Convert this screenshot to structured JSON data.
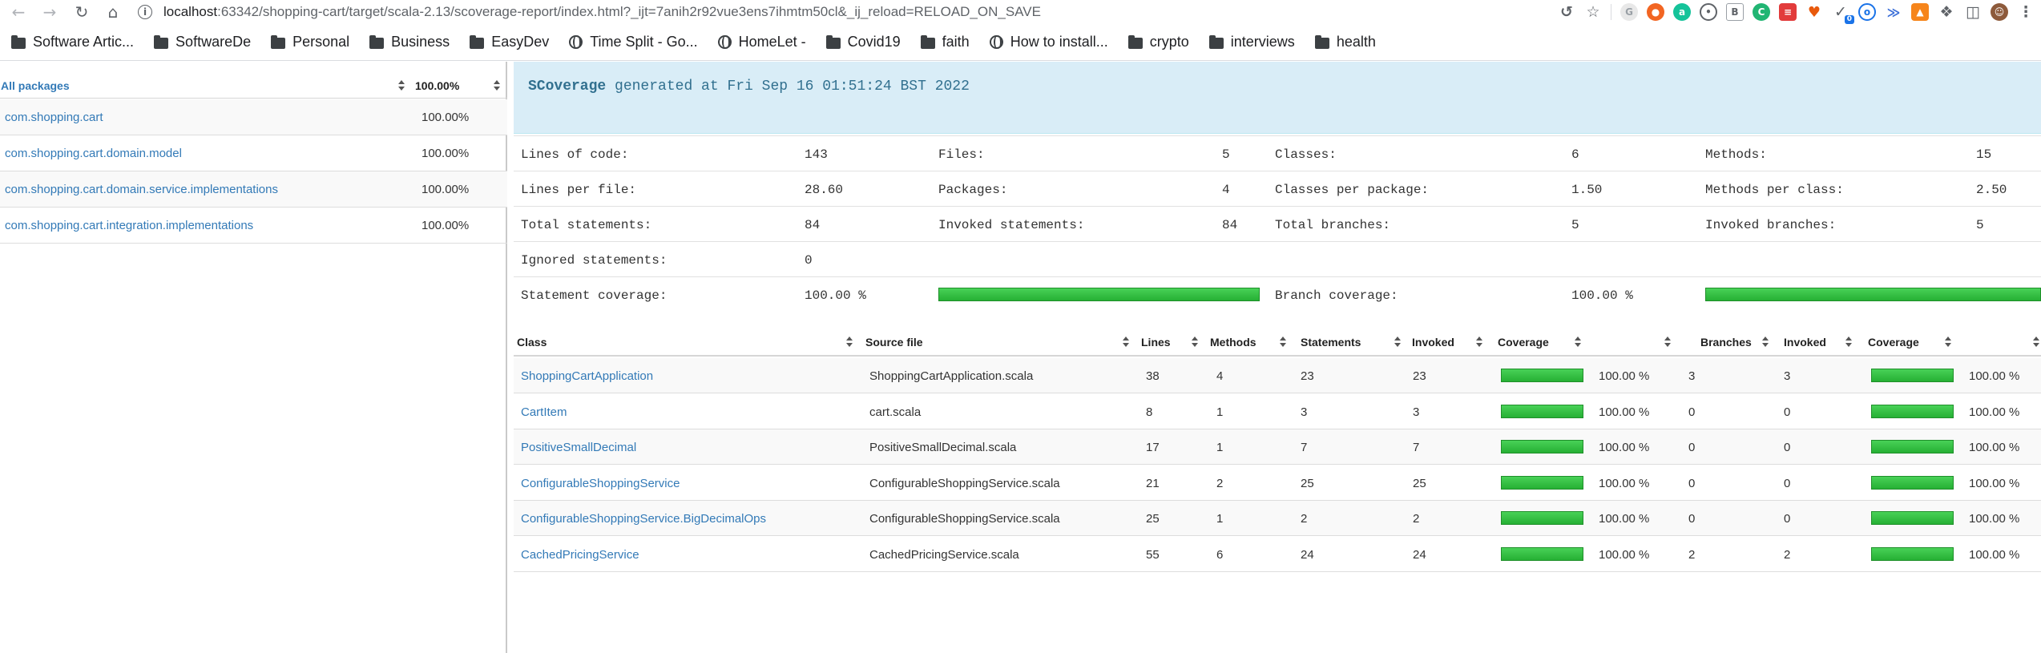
{
  "browser": {
    "url_host": "localhost",
    "url_rest": ":63342/shopping-cart/target/scala-2.13/scoverage-report/index.html?_ijt=7anih2r92vue3ens7ihmtm50cl&_ij_reload=RELOAD_ON_SAVE",
    "extension_badge": "0",
    "bookmarks": [
      {
        "label": "Software Artic...",
        "icon": "folder-icon"
      },
      {
        "label": "SoftwareDe",
        "icon": "folder-icon"
      },
      {
        "label": "Personal",
        "icon": "folder-icon"
      },
      {
        "label": "Business",
        "icon": "folder-icon"
      },
      {
        "label": "EasyDev",
        "icon": "folder-icon"
      },
      {
        "label": "Time Split - Go...",
        "icon": "globe-icon"
      },
      {
        "label": "HomeLet -",
        "icon": "globe-icon"
      },
      {
        "label": "Covid19",
        "icon": "folder-icon"
      },
      {
        "label": "faith",
        "icon": "folder-icon"
      },
      {
        "label": "How to install...",
        "icon": "globe-icon"
      },
      {
        "label": "crypto",
        "icon": "folder-icon"
      },
      {
        "label": "interviews",
        "icon": "folder-icon"
      },
      {
        "label": "health",
        "icon": "folder-icon"
      }
    ]
  },
  "packages": {
    "header_name": "All packages",
    "header_pct": "100.00%",
    "rows": [
      {
        "name": "com.shopping.cart",
        "pct": "100.00%"
      },
      {
        "name": "com.shopping.cart.domain.model",
        "pct": "100.00%"
      },
      {
        "name": "com.shopping.cart.domain.service.implementations",
        "pct": "100.00%"
      },
      {
        "name": "com.shopping.cart.integration.implementations",
        "pct": "100.00%"
      }
    ]
  },
  "report": {
    "brand": "SCoverage",
    "generated": "generated at Fri Sep 16 01:51:24 BST 2022"
  },
  "stats": {
    "lines_of_code_label": "Lines of code:",
    "lines_of_code": "143",
    "files_label": "Files:",
    "files": "5",
    "classes_label": "Classes:",
    "classes": "6",
    "methods_label": "Methods:",
    "methods": "15",
    "lines_per_file_label": "Lines per file:",
    "lines_per_file": "28.60",
    "packages_label": "Packages:",
    "packages": "4",
    "classes_per_package_label": "Classes per package:",
    "classes_per_package": "1.50",
    "methods_per_class_label": "Methods per class:",
    "methods_per_class": "2.50",
    "total_statements_label": "Total statements:",
    "total_statements": "84",
    "invoked_statements_label": "Invoked statements:",
    "invoked_statements": "84",
    "total_branches_label": "Total branches:",
    "total_branches": "5",
    "invoked_branches_label": "Invoked branches:",
    "invoked_branches": "5",
    "ignored_statements_label": "Ignored statements:",
    "ignored_statements": "0",
    "statement_coverage_label": "Statement coverage:",
    "statement_coverage": "100.00 %",
    "branch_coverage_label": "Branch coverage:",
    "branch_coverage": "100.00 %",
    "statement_coverage_fraction": 1.0,
    "branch_coverage_fraction": 1.0
  },
  "class_table": {
    "headers": {
      "class": "Class",
      "source": "Source file",
      "lines": "Lines",
      "methods": "Methods",
      "statements": "Statements",
      "invoked": "Invoked",
      "coverage": "Coverage",
      "branches": "Branches",
      "invoked2": "Invoked",
      "coverage2": "Coverage"
    },
    "rows": [
      {
        "cls": "ShoppingCartApplication",
        "src": "ShoppingCartApplication.scala",
        "lines": "38",
        "methods": "4",
        "stmts": "23",
        "inv": "23",
        "cov": "100.00 %",
        "br": "3",
        "brinv": "3",
        "brcov": "100.00 %"
      },
      {
        "cls": "CartItem",
        "src": "cart.scala",
        "lines": "8",
        "methods": "1",
        "stmts": "3",
        "inv": "3",
        "cov": "100.00 %",
        "br": "0",
        "brinv": "0",
        "brcov": "100.00 %"
      },
      {
        "cls": "PositiveSmallDecimal",
        "src": "PositiveSmallDecimal.scala",
        "lines": "17",
        "methods": "1",
        "stmts": "7",
        "inv": "7",
        "cov": "100.00 %",
        "br": "0",
        "brinv": "0",
        "brcov": "100.00 %"
      },
      {
        "cls": "ConfigurableShoppingService",
        "src": "ConfigurableShoppingService.scala",
        "lines": "21",
        "methods": "2",
        "stmts": "25",
        "inv": "25",
        "cov": "100.00 %",
        "br": "0",
        "brinv": "0",
        "brcov": "100.00 %"
      },
      {
        "cls": "ConfigurableShoppingService.BigDecimalOps",
        "src": "ConfigurableShoppingService.scala",
        "lines": "25",
        "methods": "1",
        "stmts": "2",
        "inv": "2",
        "cov": "100.00 %",
        "br": "0",
        "brinv": "0",
        "brcov": "100.00 %"
      },
      {
        "cls": "CachedPricingService",
        "src": "CachedPricingService.scala",
        "lines": "55",
        "methods": "6",
        "stmts": "24",
        "inv": "24",
        "cov": "100.00 %",
        "br": "2",
        "brinv": "2",
        "brcov": "100.00 %"
      }
    ]
  }
}
